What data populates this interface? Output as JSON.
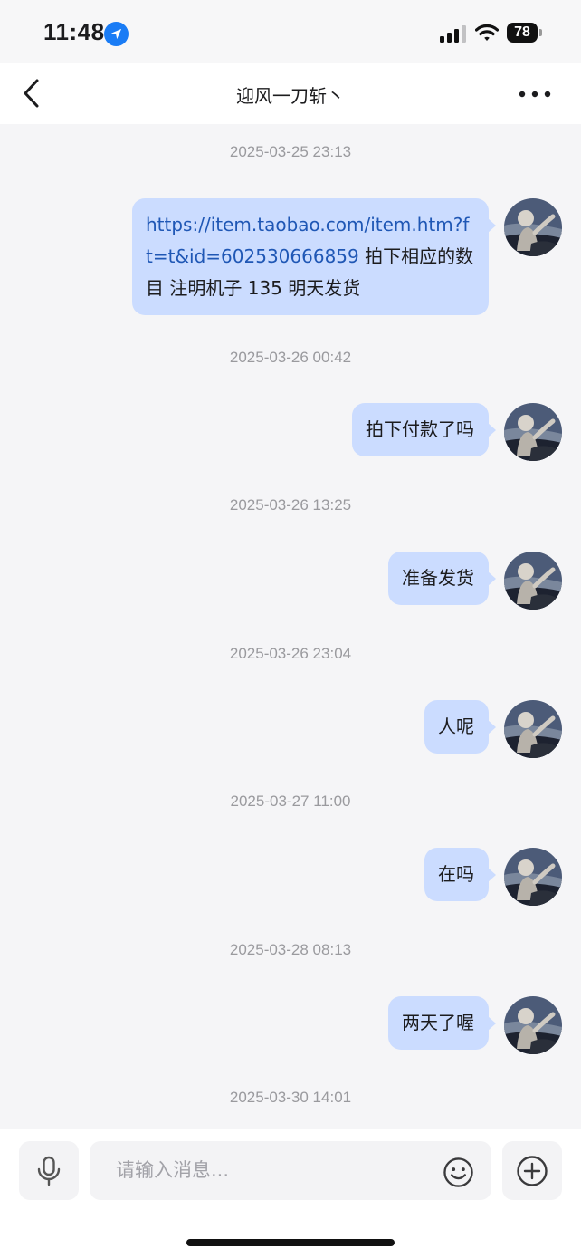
{
  "status_bar": {
    "time": "11:48",
    "battery": "78",
    "icons": [
      "location-arrow-icon",
      "cellular-signal-icon",
      "wifi-icon",
      "battery-icon"
    ]
  },
  "header": {
    "title": "迎风一刀斩丶",
    "back_icon": "chevron-left-icon",
    "more_icon": "ellipsis-icon"
  },
  "messages": [
    {
      "timestamp": "2025-03-25 23:13",
      "link": "https://item.taobao.com/item.htm?ft=t&id=602530666859",
      "text": " 拍下相应的数目 注明机子 135 明天发货"
    },
    {
      "timestamp": "2025-03-26 00:42",
      "text": "拍下付款了吗"
    },
    {
      "timestamp": "2025-03-26 13:25",
      "text": "准备发货"
    },
    {
      "timestamp": "2025-03-26 23:04",
      "text": "人呢"
    },
    {
      "timestamp": "2025-03-27 11:00",
      "text": "在吗"
    },
    {
      "timestamp": "2025-03-28 08:13",
      "text": "两天了喔"
    },
    {
      "timestamp": "2025-03-30 14:01"
    }
  ],
  "input_bar": {
    "placeholder": "请输入消息...",
    "icons": [
      "microphone-icon",
      "smiley-icon",
      "plus-circle-icon"
    ]
  },
  "colors": {
    "background": "#f5f5f7",
    "bubble": "#cbdcff",
    "link": "#1f57b5",
    "timestamp": "#9a9a9e",
    "location_badge": "#1a7cf5"
  }
}
